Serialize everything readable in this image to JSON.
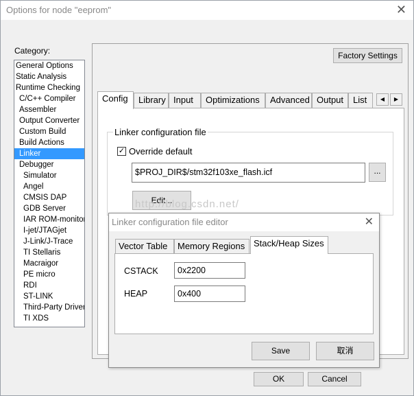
{
  "window": {
    "title": "Options for node \"eeprom\"",
    "close_glyph": "✕"
  },
  "category": {
    "label": "Category:",
    "items": [
      {
        "label": "General Options",
        "level": 0
      },
      {
        "label": "Static Analysis",
        "level": 0
      },
      {
        "label": "Runtime Checking",
        "level": 0
      },
      {
        "label": "C/C++ Compiler",
        "level": 1
      },
      {
        "label": "Assembler",
        "level": 1
      },
      {
        "label": "Output Converter",
        "level": 1
      },
      {
        "label": "Custom Build",
        "level": 1
      },
      {
        "label": "Build Actions",
        "level": 1
      },
      {
        "label": "Linker",
        "level": 1,
        "selected": true
      },
      {
        "label": "Debugger",
        "level": 1
      },
      {
        "label": "Simulator",
        "level": 2
      },
      {
        "label": "Angel",
        "level": 2
      },
      {
        "label": "CMSIS DAP",
        "level": 2
      },
      {
        "label": "GDB Server",
        "level": 2
      },
      {
        "label": "IAR ROM-monitor",
        "level": 2
      },
      {
        "label": "I-jet/JTAGjet",
        "level": 2
      },
      {
        "label": "J-Link/J-Trace",
        "level": 2
      },
      {
        "label": "TI Stellaris",
        "level": 2
      },
      {
        "label": "Macraigor",
        "level": 2
      },
      {
        "label": "PE micro",
        "level": 2
      },
      {
        "label": "RDI",
        "level": 2
      },
      {
        "label": "ST-LINK",
        "level": 2
      },
      {
        "label": "Third-Party Driver",
        "level": 2
      },
      {
        "label": "TI XDS",
        "level": 2
      }
    ]
  },
  "factory_settings_label": "Factory Settings",
  "tabs": [
    {
      "label": "Config",
      "active": true
    },
    {
      "label": "Library"
    },
    {
      "label": "Input"
    },
    {
      "label": "Optimizations"
    },
    {
      "label": "Advanced"
    },
    {
      "label": "Output"
    },
    {
      "label": "List"
    }
  ],
  "tab_scroll": {
    "left": "◀",
    "right": "▶"
  },
  "linker_config": {
    "group_label": "Linker configuration file",
    "override_label": "Override default",
    "override_checked": true,
    "check_glyph": "✓",
    "path_value": "$PROJ_DIR$/stm32f103xe_flash.icf",
    "browse_label": "...",
    "edit_label": "Edit..."
  },
  "watermark": "http://blog.csdn.net/",
  "editor": {
    "title": "Linker configuration file editor",
    "close_glyph": "✕",
    "tabs": [
      {
        "label": "Vector Table"
      },
      {
        "label": "Memory Regions"
      },
      {
        "label": "Stack/Heap Sizes",
        "active": true
      }
    ],
    "cstack_label": "CSTACK",
    "cstack_value": "0x2200",
    "heap_label": "HEAP",
    "heap_value": "0x400",
    "save_label": "Save",
    "cancel_label": "取消"
  },
  "ok_label": "OK",
  "cancel_label": "Cancel"
}
